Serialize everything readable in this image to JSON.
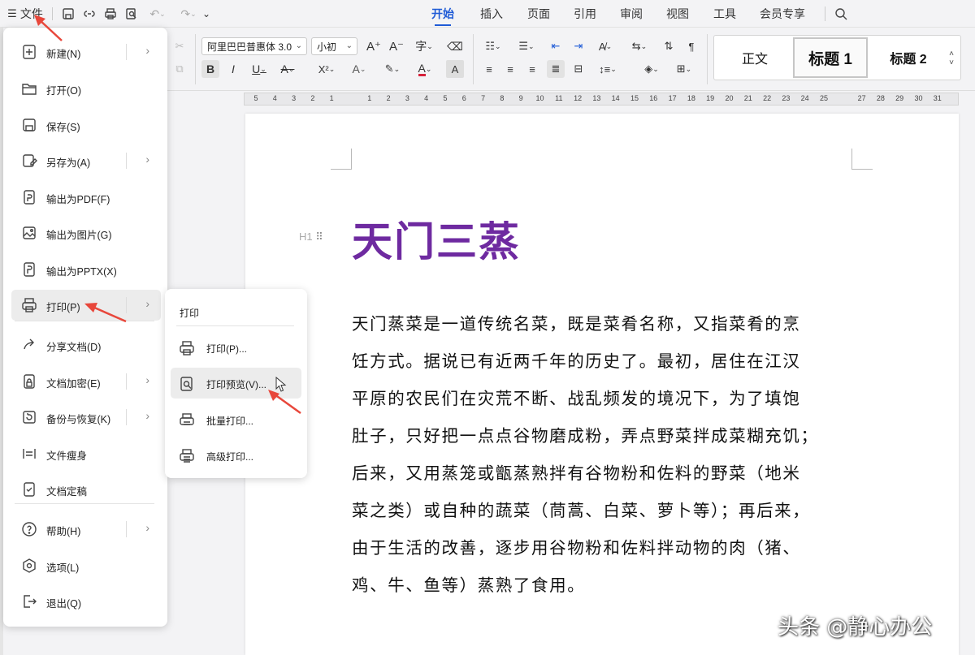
{
  "topbar": {
    "file_label": "文件",
    "tabs": [
      {
        "label": "开始",
        "active": true
      },
      {
        "label": "插入"
      },
      {
        "label": "页面"
      },
      {
        "label": "引用"
      },
      {
        "label": "审阅"
      },
      {
        "label": "视图"
      },
      {
        "label": "工具"
      },
      {
        "label": "会员专享"
      }
    ]
  },
  "ribbon": {
    "font_name": "阿里巴巴普惠体 3.0",
    "font_size": "小初",
    "styles": {
      "normal": "正文",
      "h1": "标题 1",
      "h2": "标题 2"
    }
  },
  "ruler": {
    "ticks": [
      "5",
      "4",
      "3",
      "2",
      "1",
      "",
      "1",
      "2",
      "3",
      "4",
      "5",
      "6",
      "7",
      "8",
      "9",
      "10",
      "11",
      "12",
      "13",
      "14",
      "15",
      "16",
      "17",
      "18",
      "19",
      "20",
      "21",
      "22",
      "23",
      "24",
      "25",
      "",
      "27",
      "28",
      "29",
      "30",
      "31"
    ]
  },
  "file_menu": {
    "items": [
      {
        "label": "新建(N)",
        "icon": "new-file-icon",
        "submenu": true
      },
      {
        "label": "打开(O)",
        "icon": "folder-open-icon"
      },
      {
        "label": "保存(S)",
        "icon": "save-icon"
      },
      {
        "label": "另存为(A)",
        "icon": "save-as-icon",
        "submenu": true
      },
      {
        "label": "输出为PDF(F)",
        "icon": "export-pdf-icon"
      },
      {
        "label": "输出为图片(G)",
        "icon": "export-image-icon"
      },
      {
        "label": "输出为PPTX(X)",
        "icon": "export-pptx-icon"
      },
      {
        "label": "打印(P)",
        "icon": "printer-icon",
        "submenu": true,
        "highlighted": true
      },
      {
        "label": "分享文档(D)",
        "icon": "share-icon"
      },
      {
        "label": "文档加密(E)",
        "icon": "encrypt-icon",
        "submenu": true
      },
      {
        "label": "备份与恢复(K)",
        "icon": "backup-icon",
        "submenu": true
      },
      {
        "label": "文件瘦身",
        "icon": "slim-file-icon"
      },
      {
        "label": "文档定稿",
        "icon": "finalize-icon"
      },
      {
        "label": "帮助(H)",
        "icon": "help-icon",
        "submenu": true
      },
      {
        "label": "选项(L)",
        "icon": "options-icon"
      },
      {
        "label": "退出(Q)",
        "icon": "exit-icon"
      }
    ]
  },
  "print_submenu": {
    "title": "打印",
    "items": [
      {
        "label": "打印(P)...",
        "icon": "printer-icon"
      },
      {
        "label": "打印预览(V)...",
        "icon": "print-preview-icon",
        "highlighted": true
      },
      {
        "label": "批量打印...",
        "icon": "batch-print-icon"
      },
      {
        "label": "高级打印...",
        "icon": "advanced-print-icon"
      }
    ]
  },
  "document": {
    "heading_marker": "H1",
    "title": "天门三蒸",
    "lines": [
      "天门蒸菜是一道传统名菜，既是菜肴名称，又指菜肴的烹",
      "饪方式。据说已有近两千年的历史了。最初，居住在江汉",
      "平原的农民们在灾荒不断、战乱频发的境况下，为了填饱",
      "肚子，只好把一点点谷物磨成粉，弄点野菜拌成菜糊充饥；",
      "后来，又用蒸笼或甑蒸熟拌有谷物粉和佐料的野菜（地米",
      "菜之类）或自种的蔬菜（茼蒿、白菜、萝卜等）；再后来，",
      "由于生活的改善，逐步用谷物粉和佐料拌动物的肉（猪、",
      "鸡、牛、鱼等）蒸熟了食用。"
    ]
  },
  "watermark": "头条 @静心办公",
  "colors": {
    "title": "#6e2aa0",
    "accent": "#1f5bd6",
    "annotation": "#e8473b"
  }
}
